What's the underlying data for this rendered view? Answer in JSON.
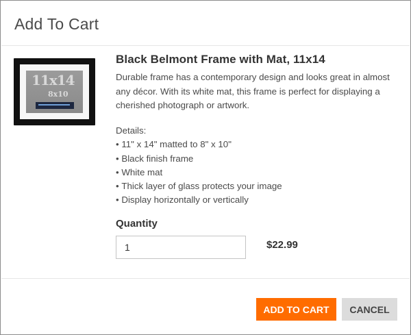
{
  "dialog": {
    "title": "Add To Cart"
  },
  "product": {
    "image_icon": "picture-frame-image",
    "image_text_large": "11x14",
    "image_text_small": "8x10",
    "name": "Black Belmont Frame with Mat, 11x14",
    "description": "Durable frame has a contemporary design and looks great in almost any décor. With its white mat, this frame is perfect for displaying a cherished photograph or artwork.",
    "details_heading": "Details:",
    "details": [
      "11\" x 14\" matted to 8\" x 10\"",
      "Black finish frame",
      "White mat",
      "Thick layer of glass protects your image",
      "Display horizontally or vertically"
    ]
  },
  "quantity": {
    "label": "Quantity",
    "value": "1"
  },
  "price": "$22.99",
  "buttons": {
    "add_to_cart": "ADD TO CART",
    "cancel": "CANCEL"
  },
  "colors": {
    "accent": "#ff6c00",
    "cancel_bg": "#dcdcdc"
  }
}
